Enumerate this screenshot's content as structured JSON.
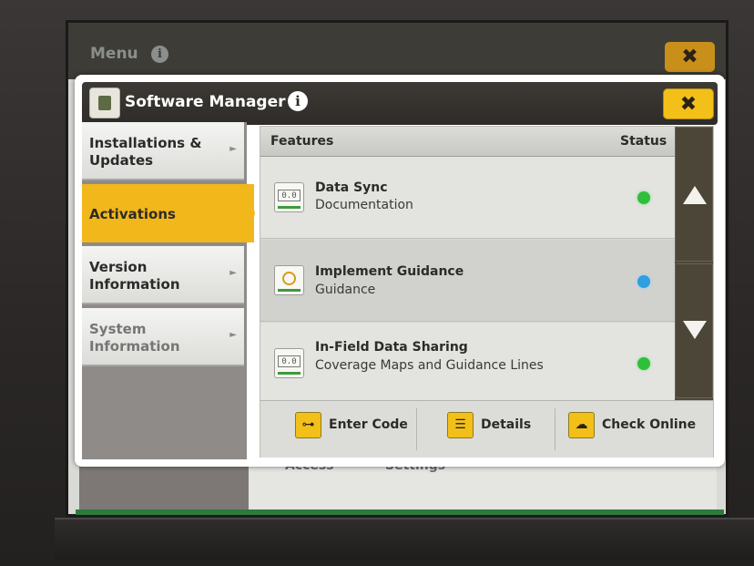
{
  "background": {
    "menu_title": "Menu",
    "menu_info": "i",
    "menu_close": "✖",
    "bottom_labels": [
      "Access",
      "Settings"
    ]
  },
  "dialog": {
    "title": "Software Manager",
    "info": "i",
    "close": "✖"
  },
  "nav": {
    "items": [
      {
        "label": "Installations & Updates",
        "active": false
      },
      {
        "label": "Activations",
        "active": true
      },
      {
        "label": "Version Information",
        "active": false
      },
      {
        "label": "System Information",
        "active": false
      }
    ]
  },
  "features": {
    "header_features": "Features",
    "header_status": "Status",
    "rows": [
      {
        "title": "Data Sync",
        "subtitle": "Documentation",
        "icon": "counter-icon",
        "status_color": "#2fbf3a"
      },
      {
        "title": "Implement Guidance",
        "subtitle": "Guidance",
        "icon": "guidance-icon",
        "status_color": "#2e9fe0"
      },
      {
        "title": "In-Field Data Sharing",
        "subtitle": "Coverage Maps and Guidance Lines",
        "icon": "counter-icon",
        "status_color": "#2fbf3a"
      }
    ]
  },
  "toolbar": {
    "enter_code": "Enter Code",
    "details": "Details",
    "check_online": "Check Online"
  },
  "colors": {
    "accent": "#f2b71b",
    "header_dark": "#2e2b28"
  }
}
